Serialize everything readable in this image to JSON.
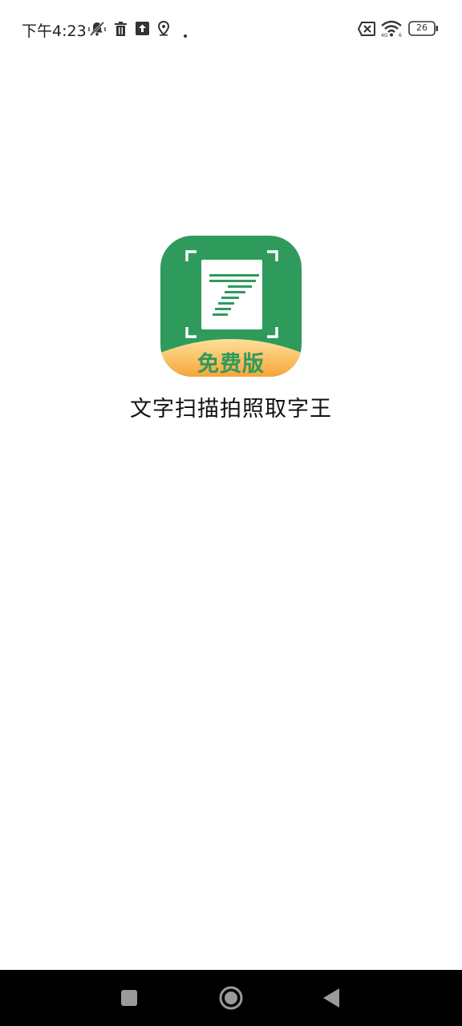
{
  "status_bar": {
    "time": "下午4:23",
    "battery_level": "26",
    "icons": [
      "bell-off-icon",
      "trash-icon",
      "upload-icon",
      "location-icon",
      "dot-icon",
      "sim-error-icon",
      "wifi-icon",
      "battery-icon"
    ]
  },
  "splash": {
    "app_icon_badge": "免费版",
    "app_name": "文字扫描拍照取字王"
  },
  "colors": {
    "icon_green": "#2e9b5d",
    "badge_orange_top": "#ffd27a",
    "badge_orange_bottom": "#f7a73b",
    "badge_text": "#2e9b5d",
    "nav_bar": "#000000"
  },
  "nav_bar": {
    "buttons": [
      "recent-apps-icon",
      "home-icon",
      "back-icon"
    ]
  }
}
